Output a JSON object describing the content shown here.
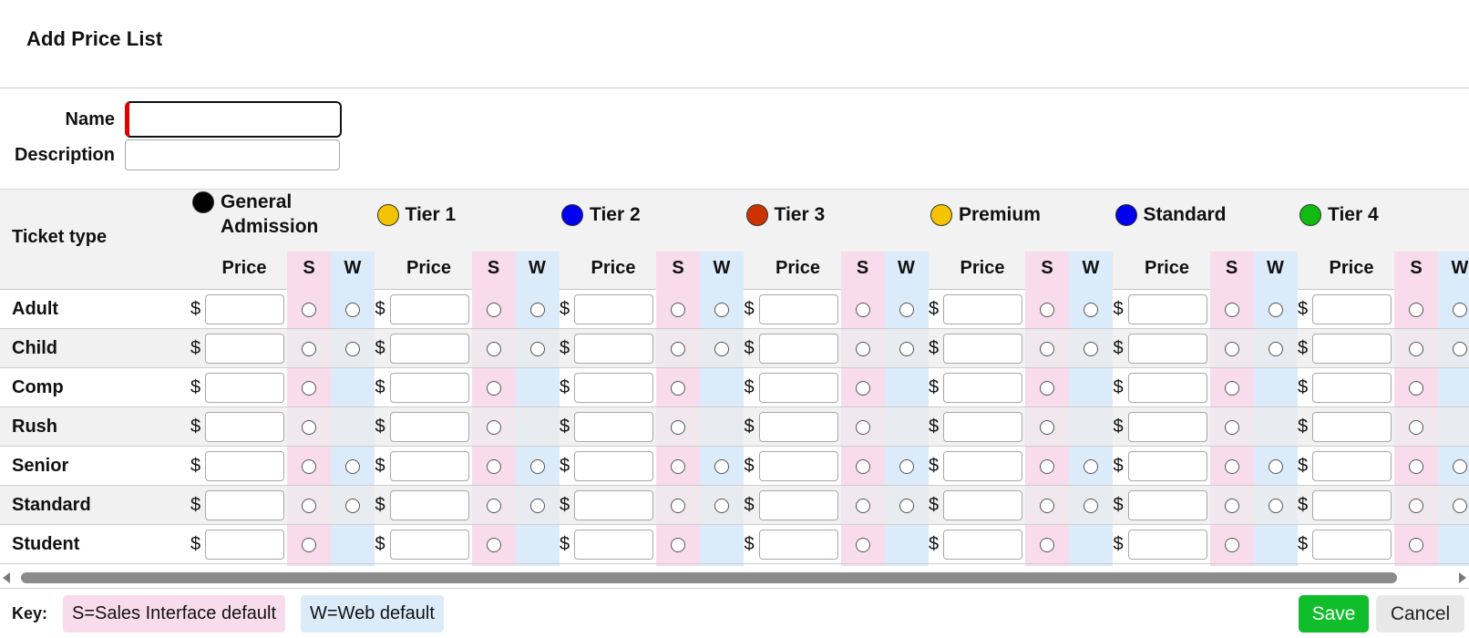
{
  "dialog": {
    "title": "Add Price List"
  },
  "form": {
    "name_label": "Name",
    "name_value": "",
    "description_label": "Description",
    "description_value": ""
  },
  "grid": {
    "ticket_type_header": "Ticket type",
    "price_header": "Price",
    "s_header": "S",
    "w_header": "W",
    "currency": "$",
    "tiers": [
      {
        "name": "General Admission",
        "color": "#000000"
      },
      {
        "name": "Tier 1",
        "color": "#f5c400"
      },
      {
        "name": "Tier 2",
        "color": "#0000ee"
      },
      {
        "name": "Tier 3",
        "color": "#cc3300"
      },
      {
        "name": "Premium",
        "color": "#f5c400"
      },
      {
        "name": "Standard",
        "color": "#0000ee"
      },
      {
        "name": "Tier 4",
        "color": "#11bb11"
      }
    ],
    "rows": [
      {
        "label": "Adult",
        "has_web": true
      },
      {
        "label": "Child",
        "has_web": true
      },
      {
        "label": "Comp",
        "has_web": false
      },
      {
        "label": "Rush",
        "has_web": false
      },
      {
        "label": "Senior",
        "has_web": true
      },
      {
        "label": "Standard",
        "has_web": true
      },
      {
        "label": "Student",
        "has_web": false
      }
    ]
  },
  "footer": {
    "key_label": "Key:",
    "s_key": "S=Sales Interface default",
    "w_key": "W=Web default",
    "save_label": "Save",
    "cancel_label": "Cancel"
  },
  "colors": {
    "sales_default": "#f9dceb",
    "web_default": "#dcebf9",
    "save_button": "#0fbe2a"
  }
}
